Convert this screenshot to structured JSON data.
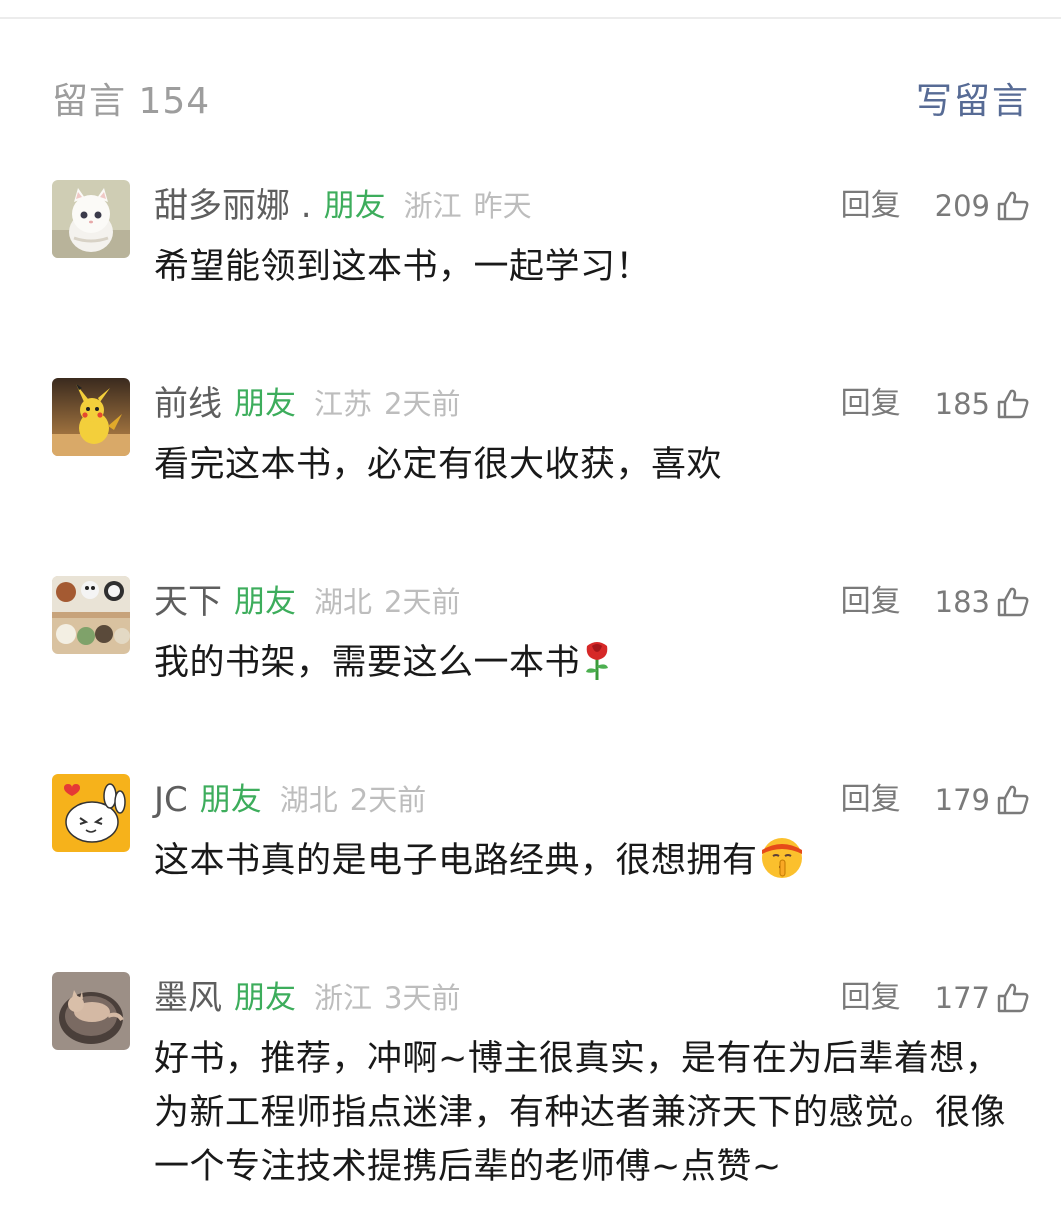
{
  "header": {
    "title": "留言 154",
    "write_label": "写留言"
  },
  "labels": {
    "friend": "朋友",
    "reply": "回复"
  },
  "comments": [
    {
      "nick": "甜多丽娜 .",
      "region": "浙江",
      "time": "昨天",
      "likes": "209",
      "content": "希望能领到这本书，一起学习！",
      "avatar": "white-kitten-avatar"
    },
    {
      "nick": "前线",
      "region": "江苏",
      "time": "2天前",
      "likes": "185",
      "content": "看完这本书，必定有很大收获，喜欢",
      "avatar": "pikachu-avatar"
    },
    {
      "nick": "天下",
      "region": "湖北",
      "time": "2天前",
      "likes": "183",
      "content": "我的书架，需要这么一本书",
      "emoji": "rose-emoji",
      "avatar": "figurines-avatar"
    },
    {
      "nick": "JC",
      "region": "湖北",
      "time": "2天前",
      "likes": "179",
      "content": "这本书真的是电子电路经典，很想拥有",
      "emoji": "shushing-face-emoji",
      "avatar": "cartoon-rabbit-avatar"
    },
    {
      "nick": "墨风",
      "region": "浙江",
      "time": "3天前",
      "likes": "177",
      "content": "好书，推荐，冲啊~博主很真实，是有在为后辈着想，为新工程师指点迷津，有种达者兼济天下的感觉。很像一个专注技术提携后辈的老师傅~点赞~",
      "avatar": "cat-in-bowl-avatar"
    }
  ],
  "colors": {
    "friend_green": "#3dad5c",
    "link_blue": "#576b95",
    "meta_gray": "#bdbdbd"
  }
}
